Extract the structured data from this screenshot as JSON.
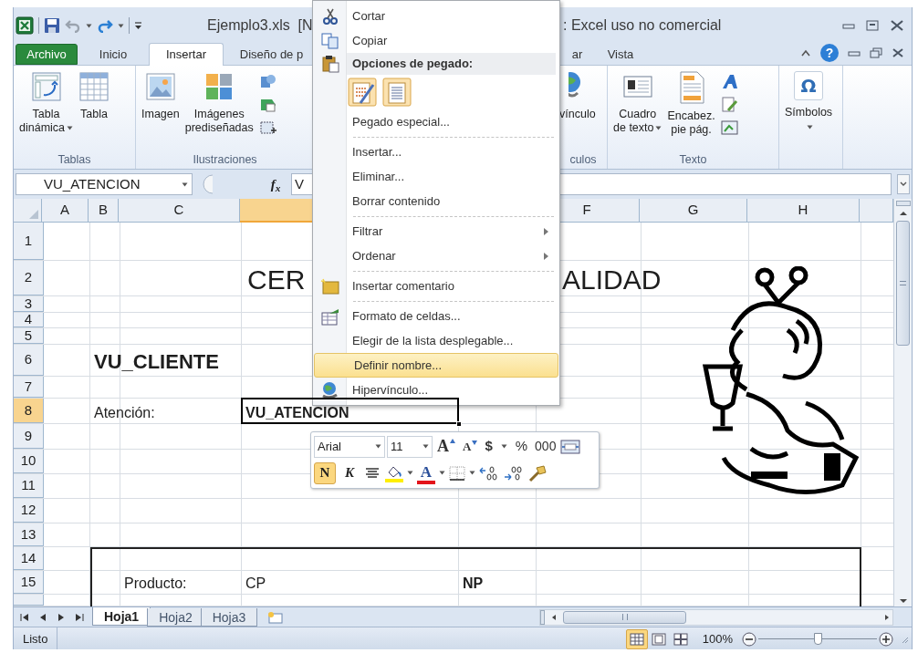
{
  "title_bar": {
    "title_start": "Ejemplo3.xls  [N",
    "title_end": ": Excel uso no comercial"
  },
  "tabs": [
    {
      "label": "Archivo",
      "kind": "file",
      "selected": false
    },
    {
      "label": "Inicio",
      "kind": "tab",
      "selected": false
    },
    {
      "label": "Insertar",
      "kind": "tab",
      "selected": true
    },
    {
      "label": "Diseño de p",
      "kind": "tab",
      "selected": false
    },
    {
      "label": "ar",
      "kind": "tab",
      "selected": false
    },
    {
      "label": "Vista",
      "kind": "tab",
      "selected": false
    }
  ],
  "help_button": "?",
  "ribbon": {
    "groups": [
      {
        "label": "Tablas",
        "buttons": [
          {
            "label": "Tabla\ndinámica",
            "dropdown": true
          },
          {
            "label": "Tabla",
            "dropdown": false
          }
        ]
      },
      {
        "label": "Ilustraciones",
        "buttons": [
          {
            "label": "Imagen",
            "dropdown": false
          },
          {
            "label": "Imágenes\nprediseñadas",
            "dropdown": false
          }
        ]
      },
      {
        "label": "culos",
        "buttons": [
          {
            "label": "vínculo",
            "dropdown": false
          }
        ]
      },
      {
        "label": "Texto",
        "buttons": [
          {
            "label": "Cuadro\nde texto",
            "dropdown": true
          },
          {
            "label": "Encabez.\npie pág.",
            "dropdown": false
          }
        ]
      },
      {
        "buttons": [
          {
            "label": "Símbolos",
            "dropdown": true,
            "glyph": "Ω"
          }
        ]
      }
    ]
  },
  "formula_bar": {
    "name_box": "VU_ATENCION",
    "fx": "f$_{x}$",
    "content": "V"
  },
  "sheet": {
    "columns": [
      {
        "label": "A",
        "selected": false
      },
      {
        "label": "B",
        "selected": false
      },
      {
        "label": "C",
        "selected": false
      },
      {
        "selected": true
      },
      {
        "label": "F",
        "selected": false
      },
      {
        "label": "G",
        "selected": false
      },
      {
        "label": "H",
        "selected": false
      },
      {
        "selected": false
      }
    ],
    "rows": [
      {
        "label": "1",
        "selected": false
      },
      {
        "label": "2",
        "selected": false,
        "cells": {
          "D": {
            "text": "CER",
            "kind": "title",
            "selected": false
          },
          "F": {
            "text": "ALIDAD",
            "kind": "title",
            "selected": false
          }
        }
      },
      {
        "label": "3",
        "selected": false
      },
      {
        "label": "4",
        "selected": false
      },
      {
        "label": "5",
        "selected": false
      },
      {
        "label": "6",
        "selected": false,
        "cells": {
          "B": {
            "text": "VU_CLIENTE",
            "kind": "heading",
            "selected": false
          }
        }
      },
      {
        "label": "7",
        "selected": false
      },
      {
        "label": "8",
        "selected": true,
        "cells": {
          "B": {
            "text": "Atención:",
            "kind": "text",
            "selected": false
          },
          "D": {
            "text": "VU_ATENCION",
            "kind": "strong",
            "selected": true
          }
        }
      },
      {
        "label": "9",
        "selected": false
      },
      {
        "label": "10",
        "selected": false
      },
      {
        "label": "11",
        "selected": false
      },
      {
        "label": "12",
        "selected": false
      },
      {
        "label": "13",
        "selected": false
      },
      {
        "label": "14",
        "selected": false
      },
      {
        "label": "15",
        "selected": false,
        "cells": {
          "C": {
            "text": "Producto:",
            "kind": "text",
            "selected": false
          },
          "D": {
            "text": "CP",
            "kind": "text",
            "selected": false
          },
          "E": {
            "text": "NP",
            "kind": "strong",
            "selected": false
          }
        }
      },
      {
        "selected": false
      }
    ]
  },
  "context_menu": {
    "items": [
      {
        "kind": "item",
        "label": "Cortar",
        "selected": false,
        "submenu": false
      },
      {
        "kind": "item",
        "label": "Copiar",
        "selected": false,
        "submenu": false
      },
      {
        "kind": "header",
        "label": "Opciones de pegado:"
      },
      {
        "kind": "paste-options"
      },
      {
        "kind": "item",
        "label": "Pegado especial...",
        "selected": false,
        "submenu": false
      },
      {
        "kind": "separator"
      },
      {
        "kind": "item",
        "label": "Insertar...",
        "selected": false,
        "submenu": false
      },
      {
        "kind": "item",
        "label": "Eliminar...",
        "selected": false,
        "submenu": false
      },
      {
        "kind": "item",
        "label": "Borrar contenido",
        "selected": false,
        "submenu": false
      },
      {
        "kind": "separator"
      },
      {
        "kind": "item",
        "label": "Filtrar",
        "selected": false,
        "submenu": true
      },
      {
        "kind": "item",
        "label": "Ordenar",
        "selected": false,
        "submenu": true
      },
      {
        "kind": "separator"
      },
      {
        "kind": "item",
        "label": "Insertar comentario",
        "selected": false,
        "submenu": false
      },
      {
        "kind": "separator"
      },
      {
        "kind": "item",
        "label": "Formato de celdas...",
        "selected": false,
        "submenu": false
      },
      {
        "kind": "item",
        "label": "Elegir de la lista desplegable...",
        "selected": false,
        "submenu": false
      },
      {
        "kind": "item",
        "label": "Definir nombre...",
        "selected": true,
        "submenu": false
      },
      {
        "kind": "item",
        "label": "Hipervínculo...",
        "selected": false,
        "submenu": false
      }
    ]
  },
  "mini_toolbar": {
    "font": "Arial",
    "size": "11",
    "buttons": [
      "A",
      "A",
      "$",
      "%",
      "000"
    ],
    "format_buttons": [
      {
        "label": "N",
        "selected": true
      },
      {
        "label": "K",
        "selected": false
      }
    ],
    "font_color": "A"
  },
  "sheet_tabs": [
    {
      "label": "Hoja1",
      "selected": true
    },
    {
      "label": "Hoja2",
      "selected": false
    },
    {
      "label": "Hoja3",
      "selected": false
    }
  ],
  "status_bar": {
    "text": "Listo",
    "views": [
      {
        "selected": true
      },
      {
        "selected": false
      },
      {
        "selected": false
      }
    ],
    "zoom": "100%",
    "zoom_slider": {
      "level": 0.5
    }
  }
}
